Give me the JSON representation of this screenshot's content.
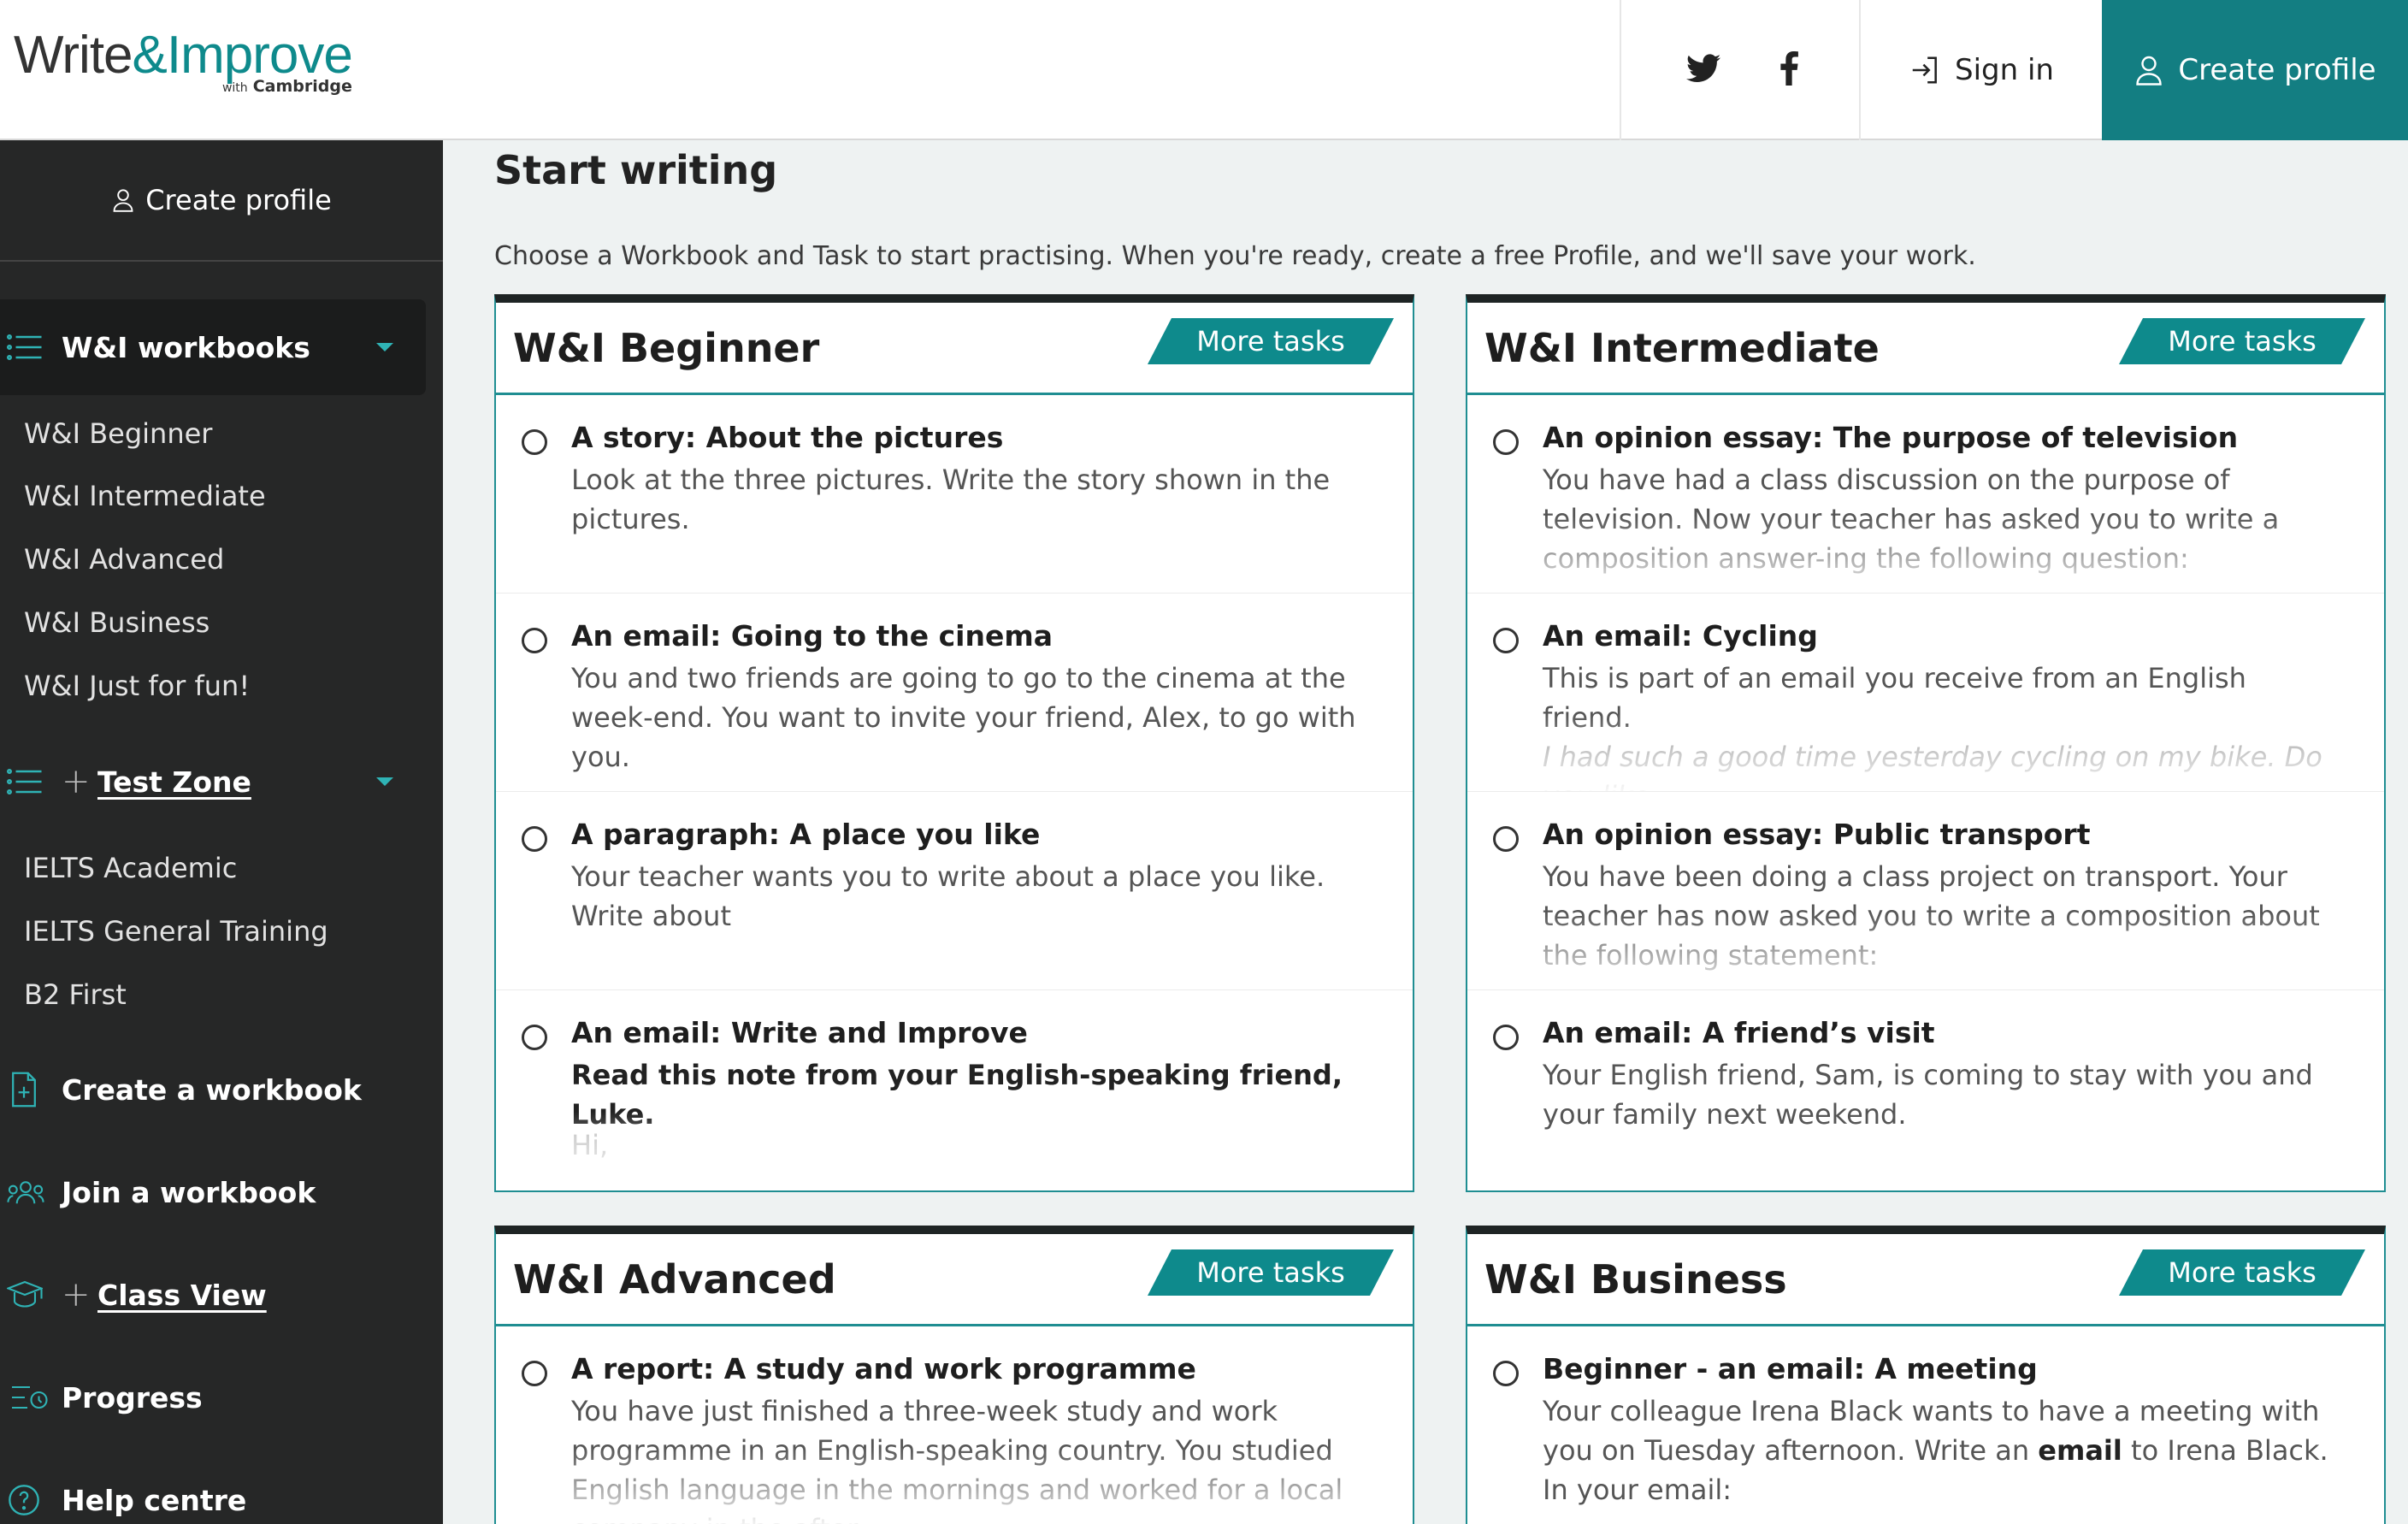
{
  "header": {
    "logo_main_1": "Write",
    "logo_amp": "&",
    "logo_main_2": "Improve",
    "logo_sub_with": "with",
    "logo_sub_brand": "Cambridge",
    "sign_in": "Sign in",
    "create_profile": "Create profile"
  },
  "sidebar": {
    "create_profile": "Create profile",
    "workbooks_label": "W&I workbooks",
    "workbook_items": [
      "W&I Beginner",
      "W&I Intermediate",
      "W&I Advanced",
      "W&I Business",
      "W&I Just for fun!"
    ],
    "test_zone_label": "Test Zone",
    "test_items": [
      "IELTS Academic",
      "IELTS General Training",
      "B2 First"
    ],
    "create_workbook": "Create a workbook",
    "join_workbook": "Join a workbook",
    "class_view": "Class View",
    "progress": "Progress",
    "help_centre": "Help centre"
  },
  "main": {
    "title": "Start writing",
    "intro": "Choose a Workbook and Task to start practising. When you're ready, create a free Profile, and we'll save your work.",
    "more_tasks": "More tasks",
    "cards": [
      {
        "title": "W&I Beginner",
        "tasks": [
          {
            "title": "A story: About the pictures",
            "desc": "Look at the three pictures. Write the story shown in the pictures."
          },
          {
            "title": "An email: Going to the cinema",
            "desc": "You and two friends are going to go to the cinema at the week-end. You want to invite your friend, Alex, to go with you."
          },
          {
            "title": "A paragraph: A place you like",
            "desc": "Your teacher wants you to write about a place you like. Write about"
          },
          {
            "title": "An email: Write and Improve",
            "desc": "Read this note from your English-speaking friend, Luke.",
            "extra": "Hi,"
          }
        ]
      },
      {
        "title": "W&I Intermediate",
        "tasks": [
          {
            "title": "An opinion essay: The purpose of television",
            "desc": "You have had a class discussion on the purpose of television. Now your teacher has asked you to write a composition answer-ing the following question:"
          },
          {
            "title": "An email: Cycling",
            "desc": "This is part of an email you receive from an English friend.",
            "extra": "I had such a good time yesterday cycling on my bike. Do you like"
          },
          {
            "title": "An opinion essay: Public transport",
            "desc": "You have been doing a class project on transport. Your teacher has now asked you to write a composition about the following statement:"
          },
          {
            "title": "An email: A friend’s visit",
            "desc": "Your English friend, Sam, is coming to stay with you and your family next weekend."
          }
        ]
      },
      {
        "title": "W&I Advanced",
        "tasks": [
          {
            "title": "A report: A study and work programme",
            "desc": "You have just finished a three-week study and work programme in an English-speaking country. You studied English language in the mornings and worked for a local company in the after-"
          }
        ]
      },
      {
        "title": "W&I Business",
        "tasks": [
          {
            "title": "Beginner - an email: A meeting",
            "desc_before": "Your colleague Irena Black wants to have a meeting with you on Tuesday afternoon. Write an ",
            "desc_em": "email",
            "desc_after": " to Irena Black. In your email:"
          }
        ]
      }
    ]
  },
  "colors": {
    "accent": "#0e8a8c",
    "sidebar_bg": "#262727",
    "page_bg": "#eef2f2"
  },
  "icons": [
    "twitter-icon",
    "facebook-icon",
    "sign-in-icon",
    "user-icon",
    "list-icon",
    "plus-icon",
    "document-plus-icon",
    "group-icon",
    "graduation-cap-icon",
    "progress-icon",
    "help-icon"
  ]
}
